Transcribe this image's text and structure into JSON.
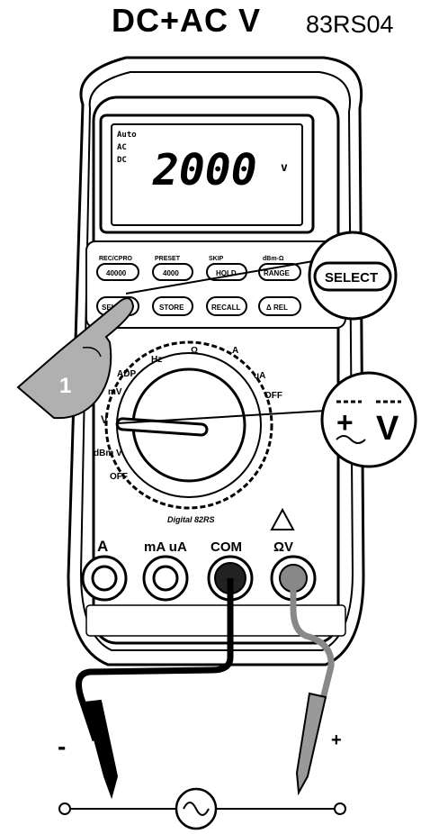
{
  "title": {
    "mode": "DC+AC V",
    "model": "83RS04"
  },
  "display": {
    "reading": "2000",
    "unit": "v",
    "indicators": [
      "Auto",
      "AC",
      "DC"
    ]
  },
  "buttons": {
    "row1": [
      "REC/CPRO",
      "PRESET",
      "SKIP",
      "dBm-Ω"
    ],
    "row1_labels": [
      "40000",
      "4000",
      "HOLD",
      "RANGE"
    ],
    "row2": [
      "SELECT",
      "STORE",
      "RECALL",
      "Δ REL"
    ],
    "select_callout": "SELECT"
  },
  "step_marker": "1",
  "dial": {
    "labels": [
      "mV",
      "ADP",
      "Hz",
      "Ω",
      "A",
      "uA",
      "OFF",
      "V",
      "dBm V",
      "OFF"
    ],
    "brand": "Digital 82RS"
  },
  "jacks": {
    "labels": [
      "A",
      "mA uA",
      "COM",
      "ΩV"
    ]
  },
  "leads": {
    "negative": "-",
    "positive": "+"
  },
  "callouts": {
    "mode_symbol": "DC+AC V"
  }
}
